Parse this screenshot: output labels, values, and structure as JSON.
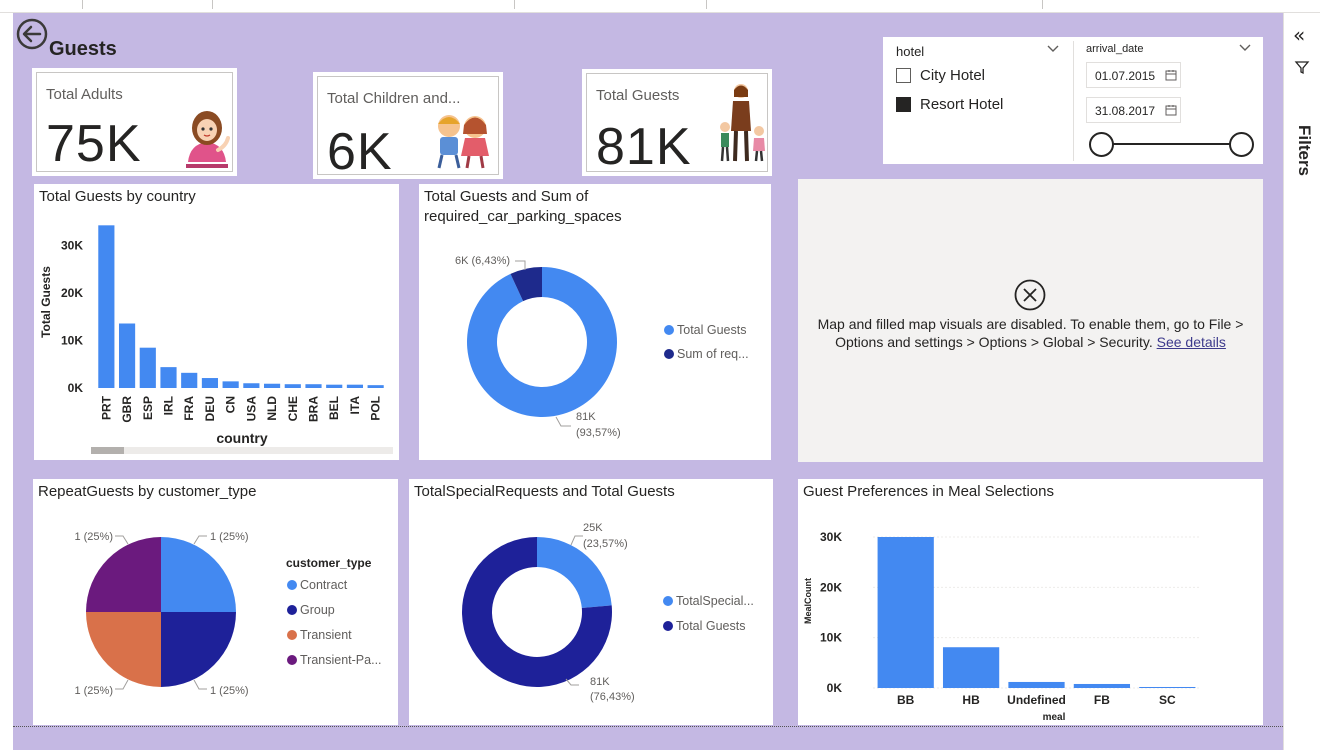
{
  "page": {
    "title": "Guests"
  },
  "kpis": [
    {
      "label": "Total Adults",
      "value": "75K",
      "icon": "woman-waving-illustration"
    },
    {
      "label": "Total Children and...",
      "value": "6K",
      "icon": "children-illustration"
    },
    {
      "label": "Total Guests",
      "value": "81K",
      "icon": "family-illustration"
    }
  ],
  "hotel_slicer": {
    "header": "hotel",
    "options": [
      {
        "label": "City Hotel",
        "checked": false
      },
      {
        "label": "Resort Hotel",
        "checked": true
      }
    ]
  },
  "date_slicer": {
    "header": "arrival_date",
    "start": "01.07.2015",
    "end": "31.08.2017"
  },
  "map_visual": {
    "message": "Map and filled map visuals are disabled. To enable them, go to File > Options and settings > Options > Global > Security.",
    "link": "See details",
    "icon": "close-circle-icon"
  },
  "filters_pane": {
    "label": "Filters"
  },
  "charts": {
    "by_country": {
      "title": "Total Guests by country"
    },
    "parking": {
      "title": "Total Guests and Sum of required_car_parking_spaces"
    },
    "repeat": {
      "title": "RepeatGuests by customer_type"
    },
    "special": {
      "title": "TotalSpecialRequests and Total Guests"
    },
    "meal": {
      "title": "Guest Preferences in Meal Selections"
    }
  },
  "chart_data": [
    {
      "type": "bar",
      "title": "Total Guests by country",
      "xlabel": "country",
      "ylabel": "Total Guests",
      "categories": [
        "PRT",
        "GBR",
        "ESP",
        "IRL",
        "FRA",
        "DEU",
        "CN",
        "USA",
        "NLD",
        "CHE",
        "BRA",
        "BEL",
        "ITA",
        "POL"
      ],
      "values": [
        34300,
        13600,
        8500,
        4400,
        3200,
        2100,
        1400,
        1000,
        900,
        800,
        800,
        700,
        700,
        600
      ],
      "yticks": [
        "0K",
        "10K",
        "20K",
        "30K"
      ],
      "ylim": [
        0,
        35000
      ],
      "color": "#4389f1"
    },
    {
      "type": "pie",
      "donut": true,
      "title": "Total Guests and Sum of required_car_parking_spaces",
      "slices": [
        {
          "name": "Total Guests",
          "legend": "Total Guests",
          "value": 81,
          "label": "81K",
          "percent": "(93,57%)",
          "color": "#4389f1"
        },
        {
          "name": "Sum of required_car_parking_spaces",
          "legend": "Sum of req...",
          "value": 6,
          "label": "6K (6,43%)",
          "percent": "",
          "color": "#1e2a8c"
        }
      ]
    },
    {
      "type": "pie",
      "title": "RepeatGuests by customer_type",
      "legend_title": "customer_type",
      "slices": [
        {
          "name": "Contract",
          "value": 1,
          "label": "1 (25%)",
          "color": "#4389f1"
        },
        {
          "name": "Group",
          "value": 1,
          "label": "1 (25%)",
          "color": "#1e2199"
        },
        {
          "name": "Transient",
          "value": 1,
          "label": "1 (25%)",
          "color": "#d9714a"
        },
        {
          "name": "Transient-Pa...",
          "value": 1,
          "label": "1 (25%)",
          "color": "#6b1a7e"
        }
      ]
    },
    {
      "type": "pie",
      "donut": true,
      "title": "TotalSpecialRequests and Total Guests",
      "slices": [
        {
          "name": "TotalSpecial...",
          "value": 25,
          "label": "25K",
          "percent": "(23,57%)",
          "color": "#4389f1"
        },
        {
          "name": "Total Guests",
          "value": 81,
          "label": "81K",
          "percent": "(76,43%)",
          "color": "#1e2199"
        }
      ]
    },
    {
      "type": "bar",
      "title": "Guest Preferences in Meal Selections",
      "xlabel": "meal",
      "ylabel": "MealCount",
      "categories": [
        "BB",
        "HB",
        "Undefined",
        "FB",
        "SC"
      ],
      "values": [
        30000,
        8100,
        1200,
        800,
        200
      ],
      "yticks": [
        "0K",
        "10K",
        "20K",
        "30K"
      ],
      "ylim": [
        0,
        30000
      ],
      "color": "#4389f1"
    }
  ]
}
